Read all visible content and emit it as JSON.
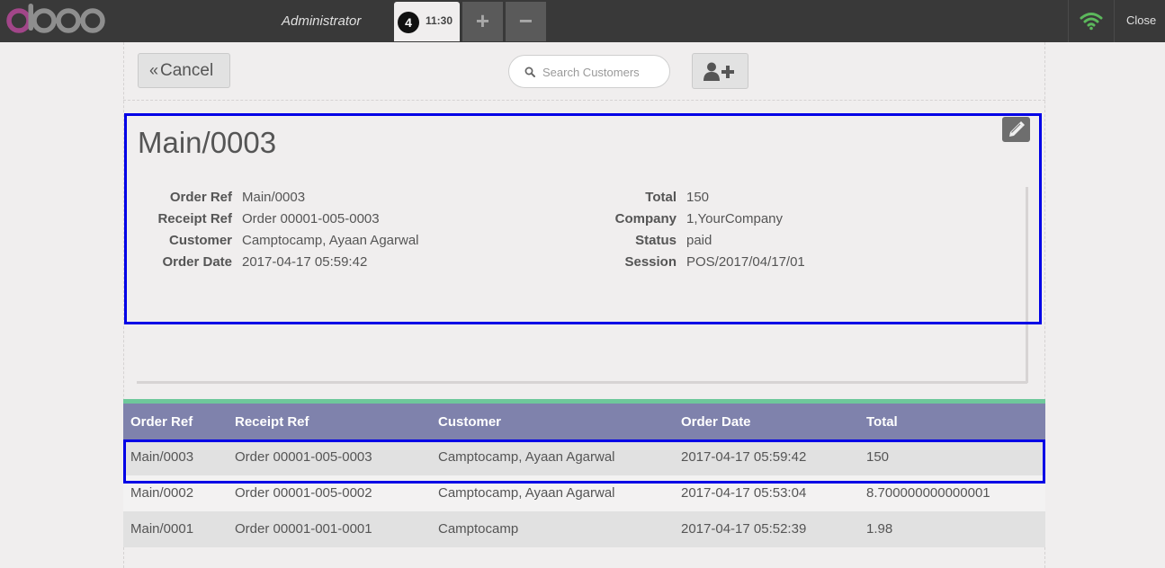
{
  "topbar": {
    "user": "Administrator",
    "order_tab": {
      "badge": "4",
      "time": "11:30"
    },
    "add_tab": "+",
    "remove_tab": "−",
    "close": "Close",
    "colors": {
      "bar": "#393939",
      "wifi": "#5cb85c",
      "logo": "#a24689"
    }
  },
  "controls": {
    "cancel_label": "Cancel",
    "search_placeholder": "Search Customers"
  },
  "details": {
    "title": "Main/0003",
    "left": [
      {
        "label": "Order Ref",
        "value": "Main/0003"
      },
      {
        "label": "Receipt Ref",
        "value": "Order 00001-005-0003"
      },
      {
        "label": "Customer",
        "value": "Camptocamp, Ayaan Agarwal"
      },
      {
        "label": "Order Date",
        "value": "2017-04-17 05:59:42"
      }
    ],
    "right": [
      {
        "label": "Total",
        "value": "150"
      },
      {
        "label": "Company",
        "value": "1,YourCompany"
      },
      {
        "label": "Status",
        "value": "paid"
      },
      {
        "label": "Session",
        "value": "POS/2017/04/17/01"
      }
    ]
  },
  "table": {
    "columns": [
      "Order Ref",
      "Receipt Ref",
      "Customer",
      "Order Date",
      "Total"
    ],
    "rows": [
      [
        "Main/0003",
        "Order 00001-005-0003",
        "Camptocamp, Ayaan Agarwal",
        "2017-04-17 05:59:42",
        "150"
      ],
      [
        "Main/0002",
        "Order 00001-005-0002",
        "Camptocamp, Ayaan Agarwal",
        "2017-04-17 05:53:04",
        "8.700000000000001"
      ],
      [
        "Main/0001",
        "Order 00001-001-0001",
        "Camptocamp",
        "2017-04-17 05:52:39",
        "1.98"
      ]
    ],
    "colors": {
      "header": "#7f82ac",
      "accent": "#6ec89b",
      "highlight_border": "#0000e6"
    }
  }
}
